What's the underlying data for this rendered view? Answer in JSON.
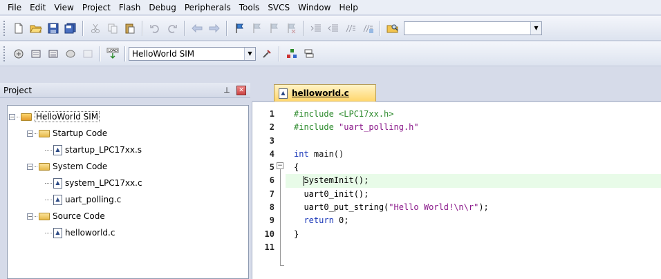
{
  "menu": [
    "File",
    "Edit",
    "View",
    "Project",
    "Flash",
    "Debug",
    "Peripherals",
    "Tools",
    "SVCS",
    "Window",
    "Help"
  ],
  "toolbar1": {
    "combo_value": ""
  },
  "toolbar2": {
    "target_select": "HelloWorld SIM"
  },
  "project_panel": {
    "title": "Project",
    "tree": [
      {
        "label": "HelloWorld SIM",
        "level": 0,
        "type": "root"
      },
      {
        "label": "Startup Code",
        "level": 1,
        "type": "folder"
      },
      {
        "label": "startup_LPC17xx.s",
        "level": 2,
        "type": "file"
      },
      {
        "label": "System Code",
        "level": 1,
        "type": "folder"
      },
      {
        "label": "system_LPC17xx.c",
        "level": 2,
        "type": "file"
      },
      {
        "label": "uart_polling.c",
        "level": 2,
        "type": "file"
      },
      {
        "label": "Source Code",
        "level": 1,
        "type": "folder"
      },
      {
        "label": "helloworld.c",
        "level": 2,
        "type": "file"
      }
    ]
  },
  "editor": {
    "tab_label": "helloworld.c",
    "line_numbers": [
      "1",
      "2",
      "3",
      "4",
      "5",
      "6",
      "7",
      "8",
      "9",
      "10",
      "11"
    ],
    "code": {
      "l1_directive": "#include",
      "l1_arg": " <LPC17xx.h>",
      "l2_directive": "#include",
      "l2_arg": " \"uart_polling.h\"",
      "l4_kw": "int",
      "l4_rest": " main()",
      "l5": "{",
      "l6": "SystemInit();",
      "l7": "  uart0_init();",
      "l8_fn": "  uart0_put_string(",
      "l8_str": "\"Hello World!\\n\\r\"",
      "l8_end": ");",
      "l9_kw": "  return",
      "l9_rest": " 0;",
      "l10": "}"
    }
  },
  "icons": {
    "project_pin": "pin-icon",
    "project_close": "close-icon"
  }
}
